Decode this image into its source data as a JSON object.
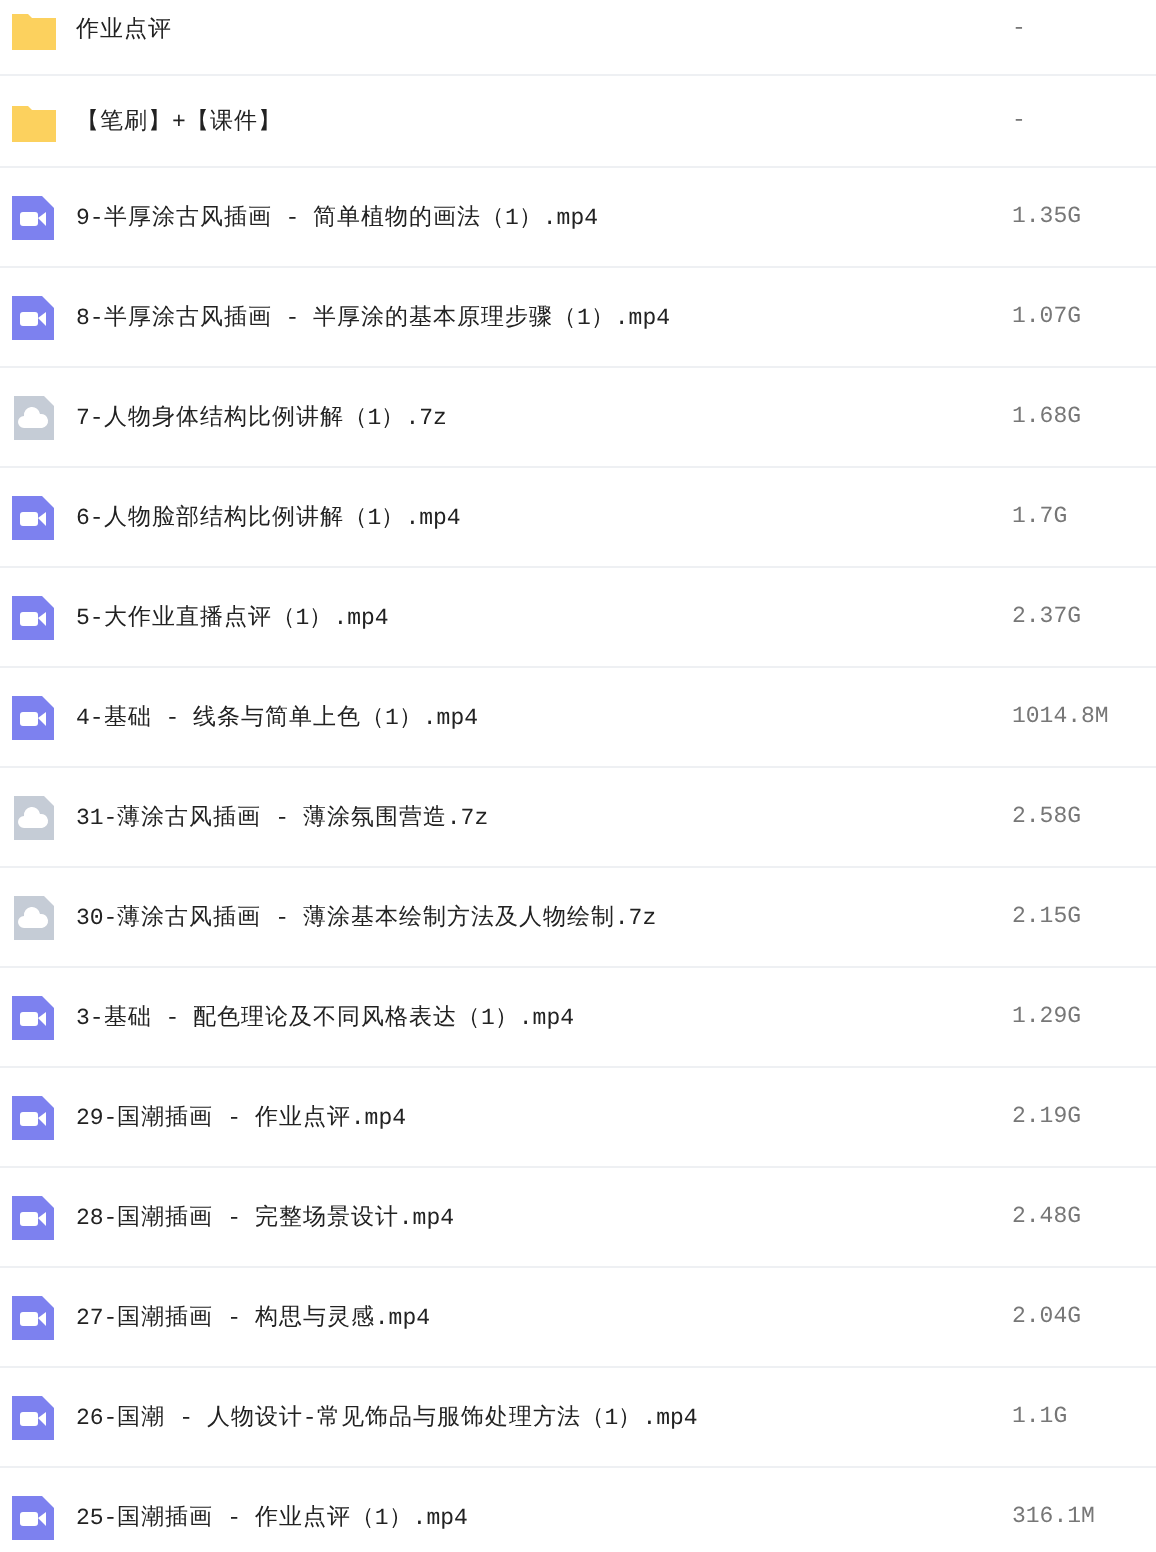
{
  "files": [
    {
      "kind": "folder",
      "name": "作业点评",
      "size": "-"
    },
    {
      "kind": "folder",
      "name": "【笔刷】+【课件】",
      "size": "-"
    },
    {
      "kind": "video",
      "name": "9-半厚涂古风插画 - 简单植物的画法（1）.mp4",
      "size": "1.35G"
    },
    {
      "kind": "video",
      "name": "8-半厚涂古风插画 - 半厚涂的基本原理步骤（1）.mp4",
      "size": "1.07G"
    },
    {
      "kind": "archive",
      "name": "7-人物身体结构比例讲解（1）.7z",
      "size": "1.68G"
    },
    {
      "kind": "video",
      "name": "6-人物脸部结构比例讲解（1）.mp4",
      "size": "1.7G"
    },
    {
      "kind": "video",
      "name": "5-大作业直播点评（1）.mp4",
      "size": "2.37G"
    },
    {
      "kind": "video",
      "name": "4-基础 - 线条与简单上色（1）.mp4",
      "size": "1014.8M"
    },
    {
      "kind": "archive",
      "name": "31-薄涂古风插画 - 薄涂氛围营造.7z",
      "size": "2.58G"
    },
    {
      "kind": "archive",
      "name": "30-薄涂古风插画 - 薄涂基本绘制方法及人物绘制.7z",
      "size": "2.15G"
    },
    {
      "kind": "video",
      "name": "3-基础 - 配色理论及不同风格表达（1）.mp4",
      "size": "1.29G"
    },
    {
      "kind": "video",
      "name": "29-国潮插画 - 作业点评.mp4",
      "size": "2.19G"
    },
    {
      "kind": "video",
      "name": "28-国潮插画 - 完整场景设计.mp4",
      "size": "2.48G"
    },
    {
      "kind": "video",
      "name": "27-国潮插画 - 构思与灵感.mp4",
      "size": "2.04G"
    },
    {
      "kind": "video",
      "name": "26-国潮 - 人物设计-常见饰品与服饰处理方法（1）.mp4",
      "size": "1.1G"
    },
    {
      "kind": "video",
      "name": "25-国潮插画 - 作业点评（1）.mp4",
      "size": "316.1M"
    }
  ]
}
